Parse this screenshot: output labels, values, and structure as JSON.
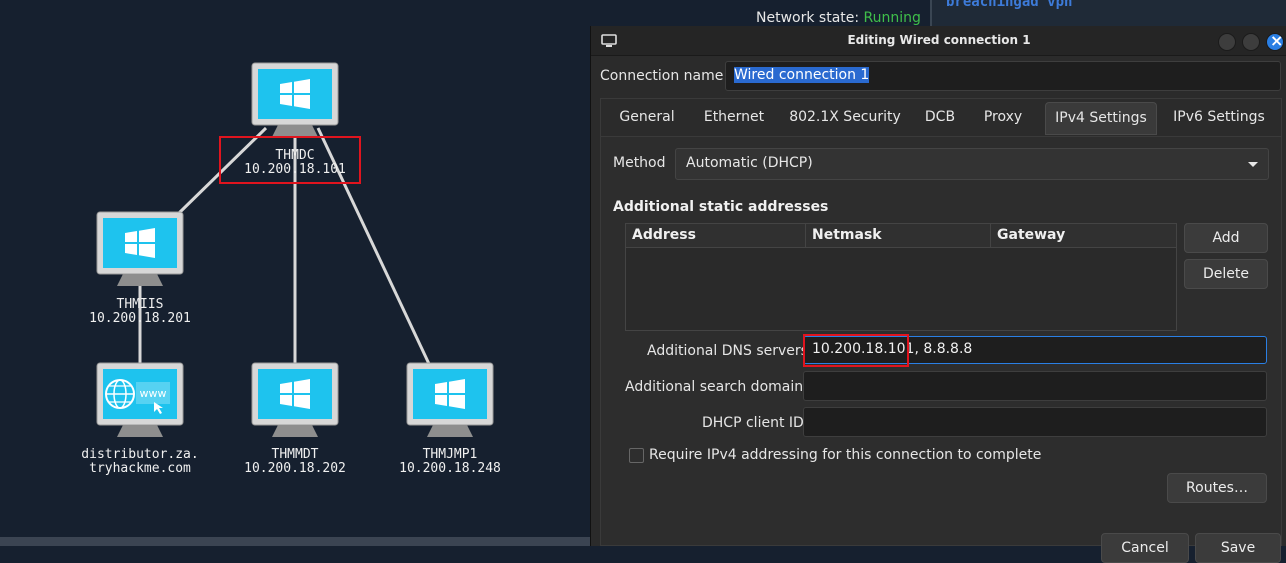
{
  "network_state": {
    "label": "Network state: ",
    "value": "Running"
  },
  "terminal_strip": {
    "text": "breachingad  vpn"
  },
  "diagram": {
    "nodes": [
      {
        "id": "thmdc",
        "name": "THMDC",
        "ip": "10.200.18.101",
        "icon": "windows-logo"
      },
      {
        "id": "thmiis",
        "name": "THMIIS",
        "ip": "10.200.18.201",
        "icon": "windows-logo"
      },
      {
        "id": "distributor",
        "name": "distributor.za.",
        "ip": "tryhackme.com",
        "icon": "globe-www"
      },
      {
        "id": "thmmdt",
        "name": "THMMDT",
        "ip": "10.200.18.202",
        "icon": "windows-logo"
      },
      {
        "id": "thmjmp1",
        "name": "THMJMP1",
        "ip": "10.200.18.248",
        "icon": "windows-logo"
      }
    ],
    "www_text": "www",
    "highlight_color": "#e0141e",
    "screen_color": "#1ec3ee"
  },
  "dialog": {
    "title": "Editing Wired connection 1",
    "connection_name_label": "Connection name",
    "connection_name_value": "Wired connection 1",
    "tabs": [
      "General",
      "Ethernet",
      "802.1X Security",
      "DCB",
      "Proxy",
      "IPv4 Settings",
      "IPv6 Settings"
    ],
    "active_tab": "IPv4 Settings",
    "method_label": "Method",
    "method_value": "Automatic (DHCP)",
    "static_title": "Additional static addresses",
    "table_headers": [
      "Address",
      "Netmask",
      "Gateway"
    ],
    "add_label": "Add",
    "delete_label": "Delete",
    "dns_label": "Additional DNS servers",
    "dns_highlight": "10.200.18.101",
    "dns_rest": ", 8.8.8.8",
    "search_label": "Additional search domains",
    "search_value": "",
    "dhcp_label": "DHCP client ID",
    "dhcp_value": "",
    "require_label": "Require IPv4 addressing for this connection to complete",
    "require_checked": false,
    "routes_label": "Routes…",
    "cancel_label": "Cancel",
    "save_label": "Save"
  }
}
